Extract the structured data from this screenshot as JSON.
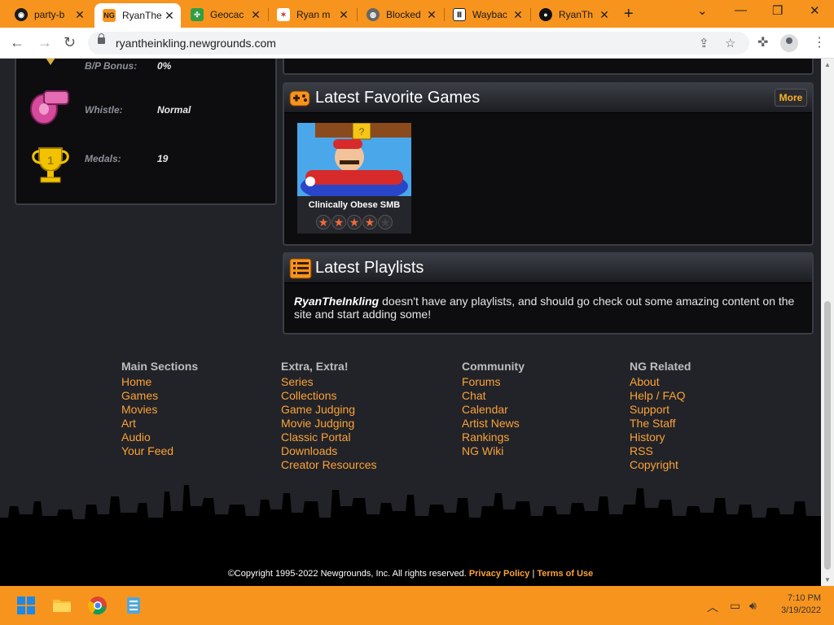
{
  "browser": {
    "tabs": [
      {
        "label": "party-b",
        "icon": "party-icon",
        "active": false
      },
      {
        "label": "RyanThe",
        "icon": "newgrounds-icon",
        "active": true
      },
      {
        "label": "Geocac",
        "icon": "geocaching-icon",
        "active": false
      },
      {
        "label": "Ryan m",
        "icon": "ryan-icon",
        "active": false
      },
      {
        "label": "Blocked",
        "icon": "globe-icon",
        "active": false
      },
      {
        "label": "Waybac",
        "icon": "wayback-icon",
        "active": false
      },
      {
        "label": "RyanTh",
        "icon": "ryan-dark-icon",
        "active": false
      }
    ],
    "url": "ryantheinkling.newgrounds.com"
  },
  "stats": [
    {
      "label": "B/P Bonus:",
      "value": "0%",
      "icon": "bp-bonus-icon"
    },
    {
      "label": "Whistle:",
      "value": "Normal",
      "icon": "whistle-icon"
    },
    {
      "label": "Medals:",
      "value": "19",
      "icon": "trophy-icon"
    }
  ],
  "favorite_games": {
    "title": "Latest Favorite Games",
    "more_label": "More",
    "games": [
      {
        "title": "Clinically Obese SMB",
        "rating": 4,
        "max_rating": 5
      }
    ]
  },
  "playlists": {
    "title": "Latest Playlists",
    "user": "RyanTheInkling",
    "message": " doesn't have any playlists, and should go check out some amazing content on the site and start adding some!"
  },
  "footer": {
    "columns": [
      {
        "heading": "Main Sections",
        "links": [
          "Home",
          "Games",
          "Movies",
          "Art",
          "Audio",
          "Your Feed"
        ]
      },
      {
        "heading": "Extra, Extra!",
        "links": [
          "Series",
          "Collections",
          "Game Judging",
          "Movie Judging",
          "Classic Portal",
          "Downloads",
          "Creator Resources"
        ]
      },
      {
        "heading": "Community",
        "links": [
          "Forums",
          "Chat",
          "Calendar",
          "Artist News",
          "Rankings",
          "NG Wiki"
        ]
      },
      {
        "heading": "NG Related",
        "links": [
          "About",
          "Help / FAQ",
          "Support",
          "The Staff",
          "History",
          "RSS",
          "Copyright"
        ]
      }
    ],
    "copyright": "©Copyright 1995-2022 Newgrounds, Inc. All rights reserved.",
    "privacy_label": "Privacy Policy",
    "separator": "|",
    "terms_label": "Terms of Use"
  },
  "taskbar": {
    "time": "7:10 PM",
    "date": "3/19/2022"
  },
  "colors": {
    "chrome_accent": "#f7941e",
    "link": "#fda238",
    "page_bg": "#212328"
  }
}
